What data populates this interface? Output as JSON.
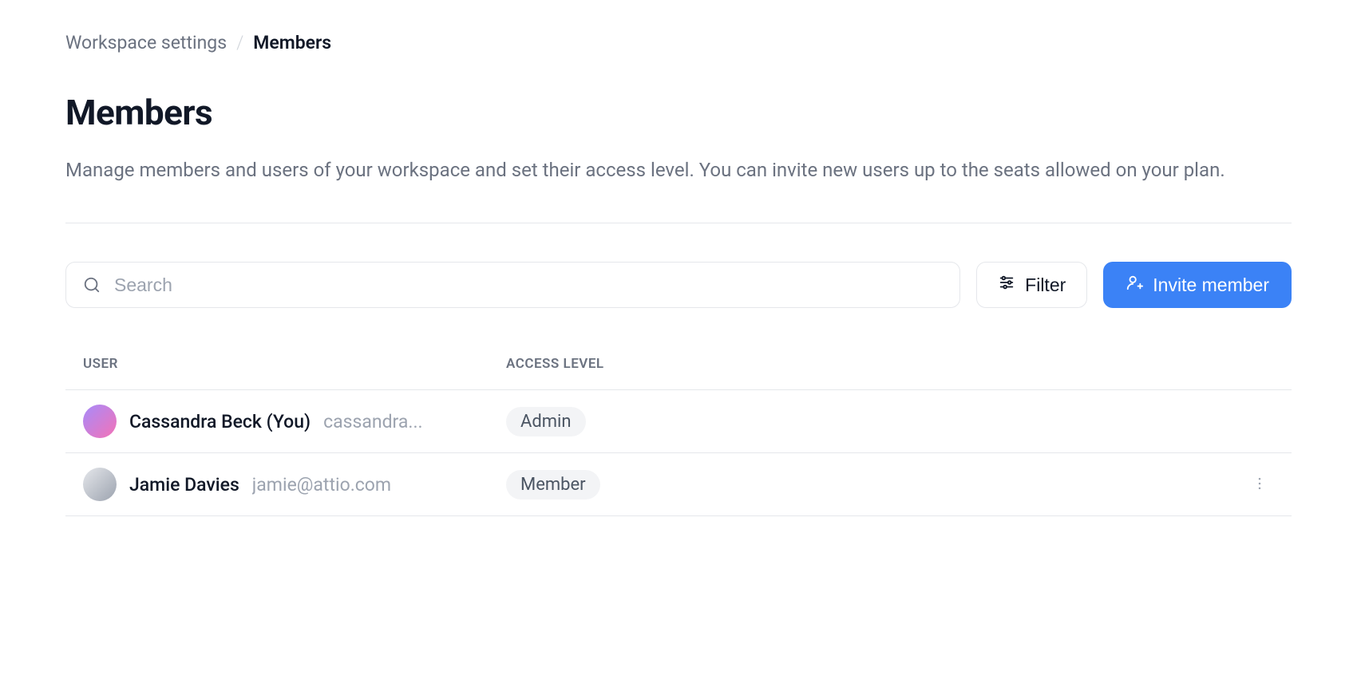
{
  "breadcrumb": {
    "parent": "Workspace settings",
    "current": "Members"
  },
  "header": {
    "title": "Members",
    "description": "Manage members and users of your workspace and set their access level. You can invite new users up to the seats allowed on your plan."
  },
  "controls": {
    "searchPlaceholder": "Search",
    "filterLabel": "Filter",
    "inviteLabel": "Invite member"
  },
  "table": {
    "columns": {
      "user": "USER",
      "access": "ACCESS LEVEL"
    },
    "rows": [
      {
        "name": "Cassandra Beck (You)",
        "email": "cassandra...",
        "role": "Admin",
        "showActions": false
      },
      {
        "name": "Jamie Davies",
        "email": "jamie@attio.com",
        "role": "Member",
        "showActions": true
      }
    ]
  }
}
